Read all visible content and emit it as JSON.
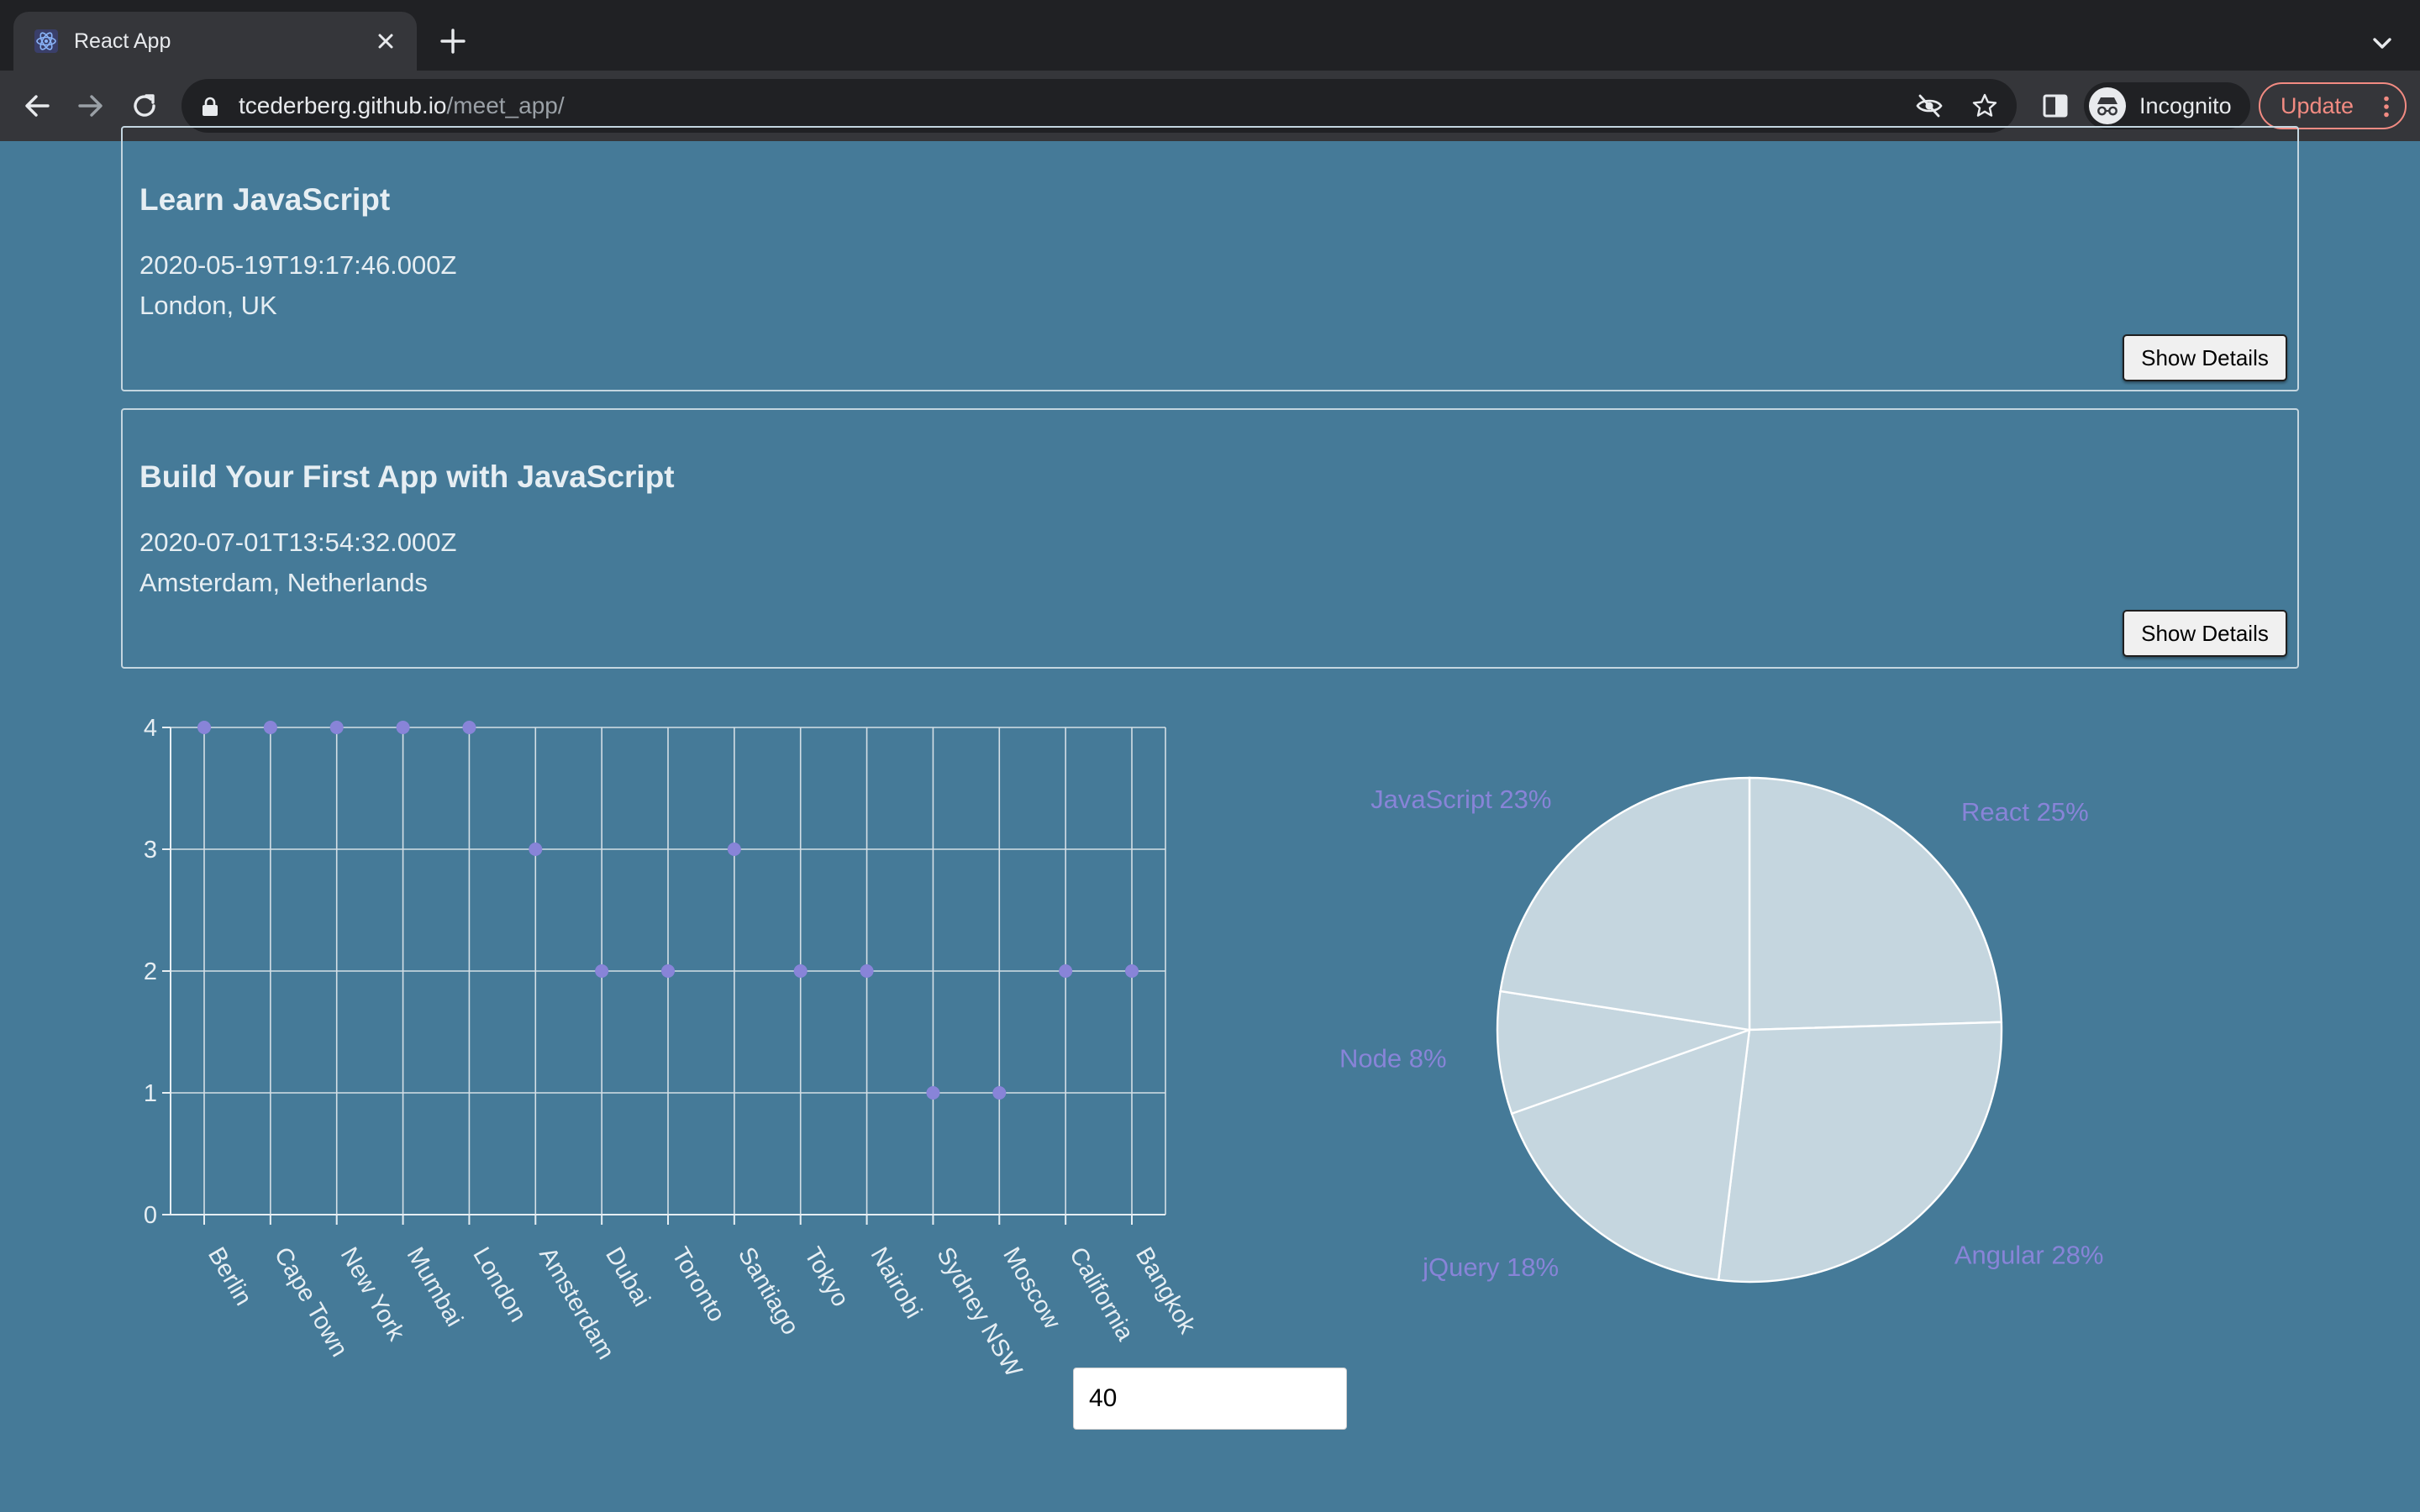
{
  "browser": {
    "tab_title": "React App",
    "url_host": "tcederberg.github.io",
    "url_path": "/meet_app/",
    "profile_label": "Incognito",
    "update_label": "Update"
  },
  "events": [
    {
      "title": "Learn JavaScript",
      "date": "2020-05-19T19:17:46.000Z",
      "location": "London, UK",
      "button_label": "Show Details"
    },
    {
      "title": "Build Your First App with JavaScript",
      "date": "2020-07-01T13:54:32.000Z",
      "location": "Amsterdam, Netherlands",
      "button_label": "Show Details"
    }
  ],
  "number_of_events": "40",
  "colors": {
    "background": "#457a98",
    "scatter_point": "#8884d8",
    "pie_fill": "#c5d6df",
    "pie_label": "#8884d8",
    "axis": "#ffffff"
  },
  "chart_data": [
    {
      "type": "scatter",
      "categories": [
        "Berlin",
        "Cape Town",
        "New York",
        "Mumbai",
        "London",
        "Amsterdam",
        "Dubai",
        "Toronto",
        "Santiago",
        "Tokyo",
        "Nairobi",
        "Sydney NSW",
        "Moscow",
        "California",
        "Bangkok"
      ],
      "values": [
        4,
        4,
        4,
        4,
        4,
        3,
        2,
        2,
        3,
        2,
        2,
        1,
        1,
        2,
        2
      ],
      "yticks": [
        0,
        1,
        2,
        3,
        4
      ],
      "ylim": [
        0,
        4
      ],
      "grid": true
    },
    {
      "type": "pie",
      "slices": [
        {
          "label": "React",
          "value": 25,
          "text": "React 25%"
        },
        {
          "label": "Angular",
          "value": 28,
          "text": "Angular 28%"
        },
        {
          "label": "jQuery",
          "value": 18,
          "text": "jQuery 18%"
        },
        {
          "label": "Node",
          "value": 8,
          "text": "Node 8%"
        },
        {
          "label": "JavaScript",
          "value": 23,
          "text": "JavaScript 23%"
        }
      ]
    }
  ]
}
